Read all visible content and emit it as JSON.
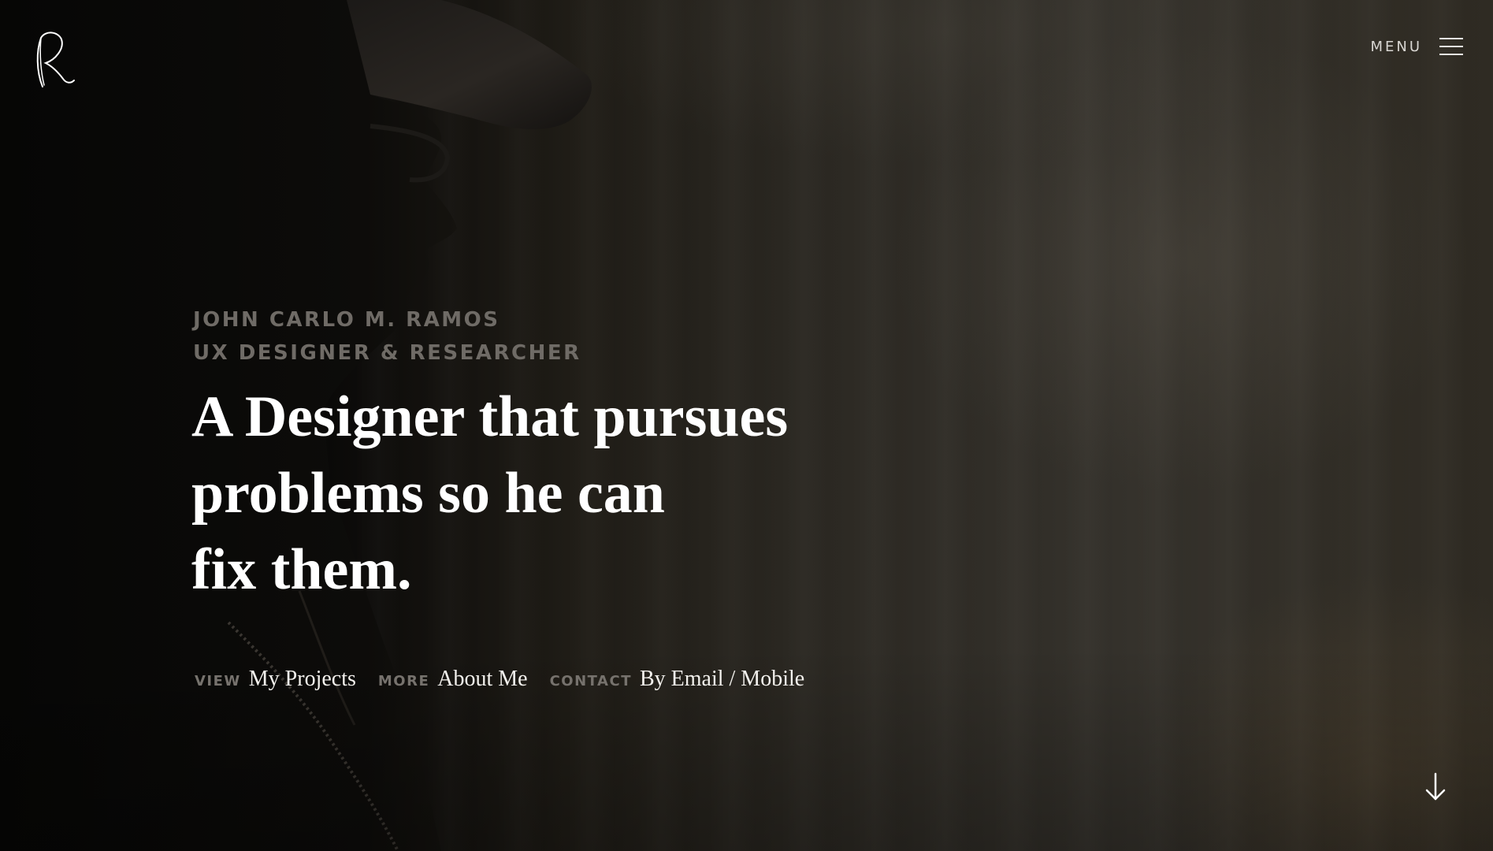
{
  "header": {
    "logo_alt": "R",
    "menu_label": "MENU",
    "menu_icon": "hamburger-icon"
  },
  "intro": {
    "name": "JOHN CARLO M. RAMOS",
    "role": "UX DESIGNER & RESEARCHER",
    "headline_lines": [
      "A Designer that pursues",
      "problems so he can",
      "fix them."
    ]
  },
  "links": [
    {
      "prefix": "VIEW",
      "label": "My Projects"
    },
    {
      "prefix": "MORE",
      "label": "About Me"
    },
    {
      "prefix": "CONTACT",
      "label": "By Email / Mobile"
    }
  ],
  "scroll": {
    "icon": "arrow-down-icon"
  },
  "colors": {
    "text_primary": "#ffffff",
    "text_muted": "#6f6b66",
    "background_dark": "#0b0a08",
    "background_warm": "#35322c"
  }
}
